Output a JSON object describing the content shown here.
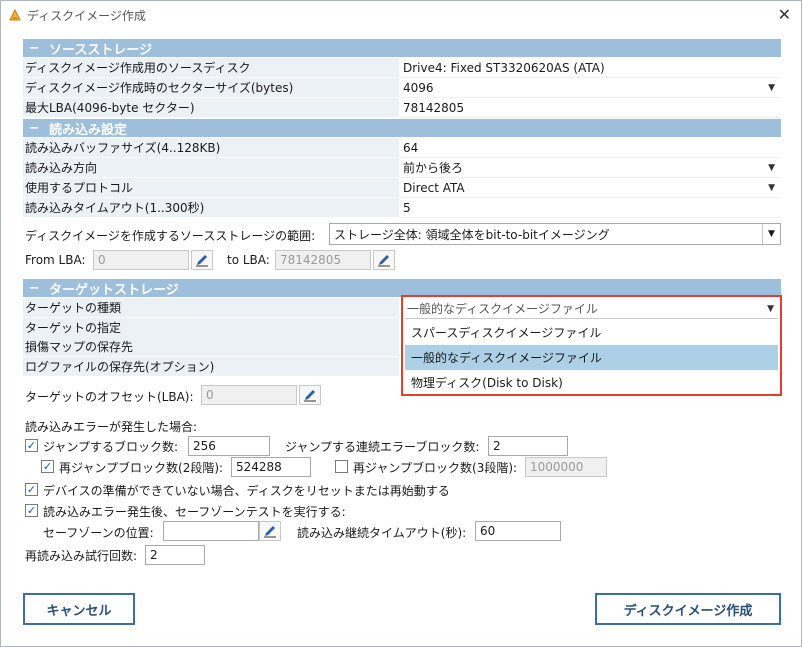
{
  "window": {
    "title": "ディスクイメージ作成",
    "close_glyph": "✕"
  },
  "source_storage": {
    "header": "ソースストレージ",
    "rows": [
      {
        "key": "ディスクイメージ作成用のソースディスク",
        "value": "Drive4: Fixed ST3320620AS (ATA)"
      },
      {
        "key": "ディスクイメージ作成時のセクターサイズ(bytes)",
        "value": "4096"
      },
      {
        "key": "最大LBA(4096-byte セクター)",
        "value": "78142805"
      }
    ]
  },
  "read_settings": {
    "header": "読み込み設定",
    "rows": [
      {
        "key": "読み込みバッファサイズ(4..128KB)",
        "value": "64"
      },
      {
        "key": "読み込み方向",
        "value": "前から後ろ"
      },
      {
        "key": "使用するプロトコル",
        "value": "Direct ATA"
      },
      {
        "key": "読み込みタイムアウト(1..300秒)",
        "value": "5"
      }
    ]
  },
  "range": {
    "label": "ディスクイメージを作成するソースストレージの範囲:",
    "value": "ストレージ全体: 領域全体をbit-to-bitイメージング",
    "from_label": "From LBA:",
    "from_value": "0",
    "to_label": "to LBA:",
    "to_value": "78142805"
  },
  "target_storage": {
    "header": "ターゲットストレージ",
    "rows": [
      {
        "key": "ターゲットの種類"
      },
      {
        "key": "ターゲットの指定"
      },
      {
        "key": "損傷マップの保存先"
      },
      {
        "key": "ログファイルの保存先(オプション)"
      }
    ],
    "dropdown": {
      "selected": "一般的なディスクイメージファイル",
      "options": [
        "スパースディスクイメージファイル",
        "一般的なディスクイメージファイル",
        "物理ディスク(Disk to Disk)"
      ]
    },
    "offset_label": "ターゲットのオフセット(LBA):",
    "offset_value": "0"
  },
  "errors": {
    "heading": "読み込みエラーが発生した場合:",
    "jump_blocks_label": "ジャンプするブロック数:",
    "jump_blocks_value": "256",
    "consecutive_label": "ジャンプする連続エラーブロック数:",
    "consecutive_value": "2",
    "rejump2_label": "再ジャンプブロック数(2段階):",
    "rejump2_value": "524288",
    "rejump3_label": "再ジャンプブロック数(3段階):",
    "rejump3_value": "1000000",
    "reset_label": "デバイスの準備ができていない場合、ディスクをリセットまたは再始動する",
    "safezone_label": "読み込みエラー発生後、セーフゾーンテストを実行する:",
    "safezone_pos_label": "セーフゾーンの位置:",
    "safezone_pos_value": "",
    "continue_timeout_label": "読み込み継続タイムアウト(秒):",
    "continue_timeout_value": "60",
    "retry_label": "再読み込み試行回数:",
    "retry_value": "2"
  },
  "buttons": {
    "cancel": "キャンセル",
    "create": "ディスクイメージ作成"
  },
  "colors": {
    "section_header": "#9dbfdc",
    "highlight": "#e53e2a",
    "selected_item": "#aed0e6"
  },
  "icons": {
    "minus": "−",
    "check": "✓",
    "arrow": "▼"
  }
}
